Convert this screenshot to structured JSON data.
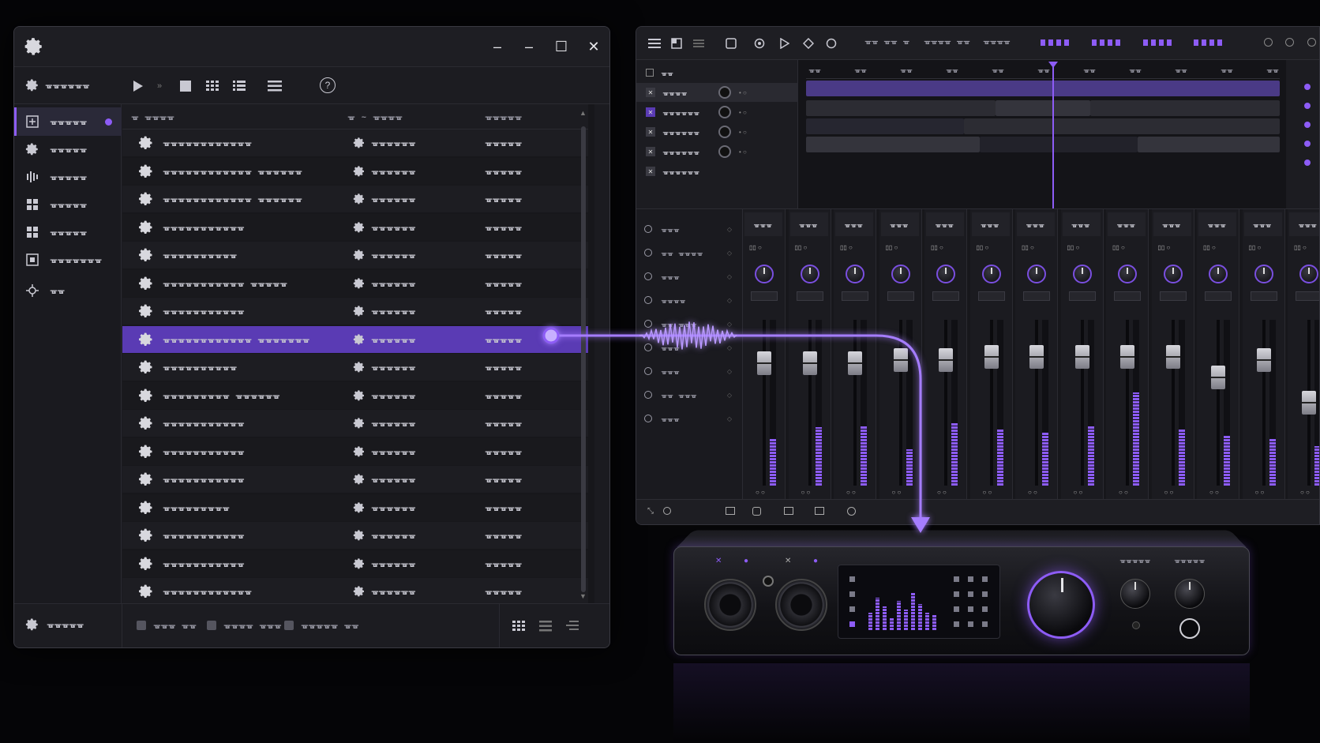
{
  "window": {
    "title_icon": "gear-icon",
    "controls": [
      "minimize-icon",
      "restore-icon",
      "maximize-icon",
      "close-icon"
    ],
    "minimize": "–",
    "restore": "–",
    "maximize": "☐",
    "close": "✕"
  },
  "toolbar": {
    "app_label": "ᚗᚗᚗᚗᚗᚗ",
    "help": "?"
  },
  "sidebar": {
    "items": [
      {
        "label": "ᚗᚗᚗᚗᚗ",
        "icon": "browse-icon",
        "active": true
      },
      {
        "label": "ᚗᚗᚗᚗᚗ",
        "icon": "gear-icon"
      },
      {
        "label": "ᚗᚗᚗᚗᚗ",
        "icon": "bars-icon"
      },
      {
        "label": "ᚗᚗᚗᚗᚗ",
        "icon": "grid-icon"
      },
      {
        "label": "ᚗᚗᚗᚗᚗ",
        "icon": "grid-icon"
      },
      {
        "label": "ᚗᚗᚗᚗᚗᚗᚗ",
        "icon": "box-icon"
      },
      {
        "label": "ᚗᚗ",
        "icon": "crosshair-icon"
      }
    ]
  },
  "table": {
    "headers": [
      "ᚗ ᚗᚗᚗᚗ",
      "ᚗ ~ ᚗᚗᚗᚗ",
      "ᚗᚗᚗᚗᚗ"
    ],
    "rows": [
      {
        "name": "ᚗᚗᚗᚗᚗᚗᚗᚗᚗᚗᚗᚗ",
        "status": "ᚗᚗᚗᚗᚗᚗ",
        "value": "ᚗᚗᚗᚗᚗ"
      },
      {
        "name": "ᚗᚗᚗᚗᚗᚗᚗᚗᚗᚗᚗᚗ ᚗᚗᚗᚗᚗᚗ",
        "status": "ᚗᚗᚗᚗᚗᚗ",
        "value": "ᚗᚗᚗᚗᚗ"
      },
      {
        "name": "ᚗᚗᚗᚗᚗᚗᚗᚗᚗᚗᚗᚗ ᚗᚗᚗᚗᚗᚗ",
        "status": "ᚗᚗᚗᚗᚗᚗ",
        "value": "ᚗᚗᚗᚗᚗ"
      },
      {
        "name": "ᚗᚗᚗᚗᚗᚗᚗᚗᚗᚗᚗ",
        "status": "ᚗᚗᚗᚗᚗᚗ",
        "value": "ᚗᚗᚗᚗᚗ"
      },
      {
        "name": "ᚗᚗᚗᚗᚗᚗᚗᚗᚗᚗ",
        "status": "ᚗᚗᚗᚗᚗᚗ",
        "value": "ᚗᚗᚗᚗᚗ"
      },
      {
        "name": "ᚗᚗᚗᚗᚗᚗᚗᚗᚗᚗᚗ ᚗᚗᚗᚗᚗ",
        "status": "ᚗᚗᚗᚗᚗᚗ",
        "value": "ᚗᚗᚗᚗᚗ"
      },
      {
        "name": "ᚗᚗᚗᚗᚗᚗᚗᚗᚗᚗᚗ",
        "status": "ᚗᚗᚗᚗᚗᚗ",
        "value": "ᚗᚗᚗᚗᚗ"
      },
      {
        "name": "ᚗᚗᚗᚗᚗᚗᚗᚗᚗᚗᚗᚗ ᚗᚗᚗᚗᚗᚗᚗ",
        "status": "ᚗᚗᚗᚗᚗᚗ",
        "value": "ᚗᚗᚗᚗᚗ",
        "selected": true
      },
      {
        "name": "ᚗᚗᚗᚗᚗᚗᚗᚗᚗᚗ",
        "status": "ᚗᚗᚗᚗᚗᚗ",
        "value": "ᚗᚗᚗᚗᚗ"
      },
      {
        "name": "ᚗᚗᚗᚗᚗᚗᚗᚗᚗ ᚗᚗᚗᚗᚗᚗ",
        "status": "ᚗᚗᚗᚗᚗᚗ",
        "value": "ᚗᚗᚗᚗᚗ"
      },
      {
        "name": "ᚗᚗᚗᚗᚗᚗᚗᚗᚗᚗᚗ",
        "status": "ᚗᚗᚗᚗᚗᚗ",
        "value": "ᚗᚗᚗᚗᚗ"
      },
      {
        "name": "ᚗᚗᚗᚗᚗᚗᚗᚗᚗᚗᚗ",
        "status": "ᚗᚗᚗᚗᚗᚗ",
        "value": "ᚗᚗᚗᚗᚗ"
      },
      {
        "name": "ᚗᚗᚗᚗᚗᚗᚗᚗᚗᚗᚗ",
        "status": "ᚗᚗᚗᚗᚗᚗ",
        "value": "ᚗᚗᚗᚗᚗ"
      },
      {
        "name": "ᚗᚗᚗᚗᚗᚗᚗᚗᚗ",
        "status": "ᚗᚗᚗᚗᚗᚗ",
        "value": "ᚗᚗᚗᚗᚗ"
      },
      {
        "name": "ᚗᚗᚗᚗᚗᚗᚗᚗᚗᚗᚗ",
        "status": "ᚗᚗᚗᚗᚗᚗ",
        "value": "ᚗᚗᚗᚗᚗ"
      },
      {
        "name": "ᚗᚗᚗᚗᚗᚗᚗᚗᚗᚗᚗ",
        "status": "ᚗᚗᚗᚗᚗᚗ",
        "value": "ᚗᚗᚗᚗᚗ"
      },
      {
        "name": "ᚗᚗᚗᚗᚗᚗᚗᚗᚗᚗᚗᚗ",
        "status": "ᚗᚗᚗᚗᚗᚗ",
        "value": "ᚗᚗᚗᚗᚗ"
      }
    ]
  },
  "footer": {
    "settings_label": "ᚗᚗᚗᚗᚗ",
    "filters": [
      "ᚗᚗᚗ ᚗᚗ",
      "ᚗᚗᚗᚗ ᚗᚗᚗ",
      "ᚗᚗᚗᚗᚗ ᚗᚗ"
    ]
  },
  "daw": {
    "transport_groups": [
      "ᚗᚗ ᚗᚗ ᚗ",
      "ᚗᚗᚗᚗ ᚗᚗ",
      "ᚗᚗᚗᚗ"
    ],
    "ruler_ticks": [
      "ᚗᚗ",
      "ᚗᚗ",
      "ᚗᚗ",
      "ᚗᚗ",
      "ᚗᚗ",
      "ᚗᚗ",
      "ᚗᚗ",
      "ᚗᚗ",
      "ᚗᚗ",
      "ᚗᚗ",
      "ᚗᚗ"
    ],
    "tracks": [
      {
        "label": "ᚗᚗ"
      },
      {
        "label": "ᚗᚗᚗᚗ",
        "active": true
      },
      {
        "label": "ᚗᚗᚗᚗᚗᚗ"
      },
      {
        "label": "ᚗᚗᚗᚗᚗᚗ"
      },
      {
        "label": "ᚗᚗᚗᚗᚗᚗ"
      },
      {
        "label": "ᚗᚗᚗᚗᚗᚗ"
      }
    ],
    "buses": [
      "ᚗᚗᚗ",
      "ᚗᚗ ᚗᚗᚗᚗ",
      "ᚗᚗᚗ",
      "ᚗᚗᚗᚗ",
      "ᚗᚗ ᚗᚗᚗ",
      "ᚗᚗᚗ",
      "ᚗᚗᚗ",
      "ᚗᚗ ᚗᚗᚗ",
      "ᚗᚗᚗ"
    ],
    "channels": [
      {
        "label": "ᚗᚗᚗ",
        "fader": 0.78,
        "meter": 0.28
      },
      {
        "label": "ᚗᚗᚗ",
        "fader": 0.78,
        "meter": 0.35
      },
      {
        "label": "ᚗᚗᚗ",
        "fader": 0.78,
        "meter": 0.36
      },
      {
        "label": "ᚗᚗᚗ",
        "fader": 0.8,
        "meter": 0.22
      },
      {
        "label": "ᚗᚗᚗ",
        "fader": 0.8,
        "meter": 0.38
      },
      {
        "label": "ᚗᚗᚗ",
        "fader": 0.82,
        "meter": 0.34
      },
      {
        "label": "ᚗᚗᚗ",
        "fader": 0.82,
        "meter": 0.32
      },
      {
        "label": "ᚗᚗᚗ",
        "fader": 0.82,
        "meter": 0.36
      },
      {
        "label": "ᚗᚗᚗ",
        "fader": 0.82,
        "meter": 0.56
      },
      {
        "label": "ᚗᚗᚗ",
        "fader": 0.82,
        "meter": 0.34
      },
      {
        "label": "ᚗᚗᚗ",
        "fader": 0.68,
        "meter": 0.3
      },
      {
        "label": "ᚗᚗᚗ",
        "fader": 0.8,
        "meter": 0.28
      },
      {
        "label": "ᚗᚗᚗ",
        "fader": 0.5,
        "meter": 0.24
      }
    ]
  },
  "hardware": {
    "knob_labels": [
      "ᚗᚗᚗᚗᚗ",
      "ᚗᚗᚗᚗᚗ"
    ]
  },
  "colors": {
    "accent": "#8d5cf6",
    "selected_row": "#5a3bb4"
  }
}
